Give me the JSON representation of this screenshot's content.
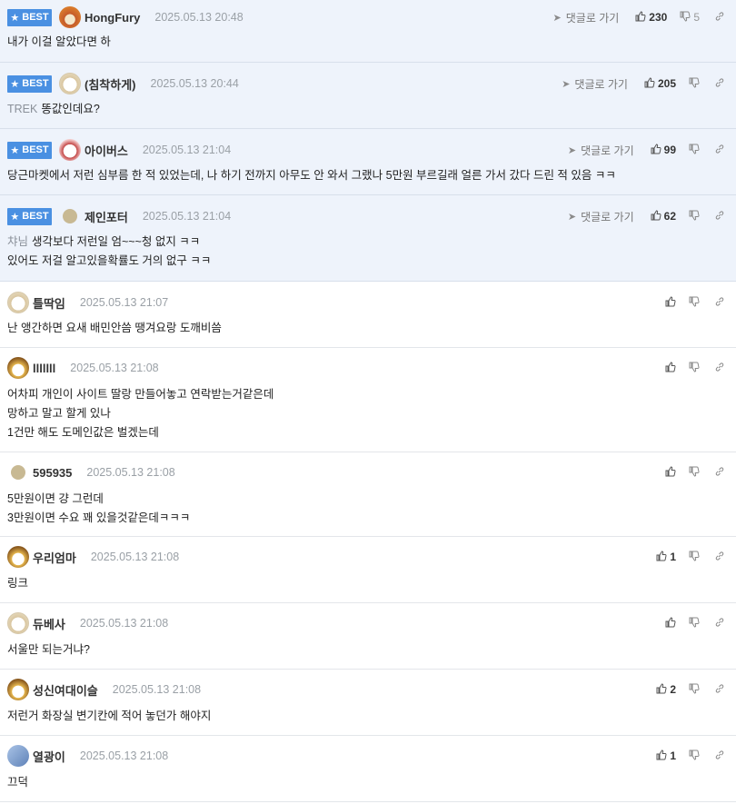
{
  "best_label": "BEST",
  "reply_label": "댓글로 가기",
  "comments": [
    {
      "name": "HongFury",
      "date": "2025.05.13 20:48",
      "best": true,
      "show_reply": true,
      "up": "230",
      "down": "5",
      "mention": "",
      "lines": [
        "내가 이걸 알았다면 하"
      ],
      "avatar": "fury-avatar"
    },
    {
      "name": "(침착하게)",
      "date": "2025.05.13 20:44",
      "best": true,
      "show_reply": true,
      "up": "205",
      "down": "",
      "mention": "TREK",
      "lines": [
        "똥값인데요?"
      ],
      "avatar": "dog-avatar"
    },
    {
      "name": "아이버스",
      "date": "2025.05.13 21:04",
      "best": true,
      "show_reply": true,
      "up": "99",
      "down": "",
      "mention": "",
      "lines": [
        "당근마켓에서 저런 심부름 한 적 있었는데, 나 하기 전까지 아무도 안 와서 그랬나 5만원 부르길래 얼른 가서 갔다 드린 적 있음 ㅋㅋ"
      ],
      "avatar": "dog2-avatar"
    },
    {
      "name": "제인포터",
      "date": "2025.05.13 21:04",
      "best": true,
      "show_reply": true,
      "up": "62",
      "down": "",
      "mention": "챠님",
      "lines": [
        "생각보다 저런일 엄~~~청 없지 ㅋㅋ",
        "있어도 저걸 알고있을확률도 거의 없구 ㅋㅋ"
      ],
      "avatar": "plain-avatar"
    },
    {
      "name": "틀딱임",
      "date": "2025.05.13 21:07",
      "best": false,
      "show_reply": false,
      "up": "",
      "down": "",
      "mention": "",
      "lines": [
        "난 앵간하면 요새 배민안씀 땡겨요랑 도깨비씀"
      ],
      "avatar": "dog-avatar"
    },
    {
      "name": "lllllll",
      "date": "2025.05.13 21:08",
      "best": false,
      "show_reply": false,
      "up": "",
      "down": "",
      "mention": "",
      "lines": [
        "어차피 개인이 사이트 딸랑 만들어놓고 연락받는거같은데",
        "망하고 말고 할게 있나",
        "1건만 해도 도메인값은 벌겠는데"
      ],
      "avatar": "fox-avatar"
    },
    {
      "name": "595935",
      "date": "2025.05.13 21:08",
      "best": false,
      "show_reply": false,
      "up": "",
      "down": "",
      "mention": "",
      "lines": [
        "5만원이면 걍 그런데",
        "3만원이면 수요 꽤 있을것같은데ㅋㅋㅋ"
      ],
      "avatar": "plain-avatar"
    },
    {
      "name": "우리엄마",
      "date": "2025.05.13 21:08",
      "best": false,
      "show_reply": false,
      "up": "1",
      "down": "",
      "mention": "",
      "lines": [
        "링크"
      ],
      "avatar": "fox-avatar"
    },
    {
      "name": "듀베사",
      "date": "2025.05.13 21:08",
      "best": false,
      "show_reply": false,
      "up": "",
      "down": "",
      "mention": "",
      "lines": [
        "서울만 되는거냐?"
      ],
      "avatar": "dog-avatar"
    },
    {
      "name": "성신여대이슬",
      "date": "2025.05.13 21:08",
      "best": false,
      "show_reply": false,
      "up": "2",
      "down": "",
      "mention": "",
      "lines": [
        "저런거 화장실 변기칸에 적어 놓던가 해야지"
      ],
      "avatar": "fox-avatar"
    },
    {
      "name": "열광이",
      "date": "2025.05.13 21:08",
      "best": false,
      "show_reply": false,
      "up": "1",
      "down": "",
      "mention": "",
      "lines": [
        "끄덕"
      ],
      "avatar": "blue-avatar"
    }
  ]
}
